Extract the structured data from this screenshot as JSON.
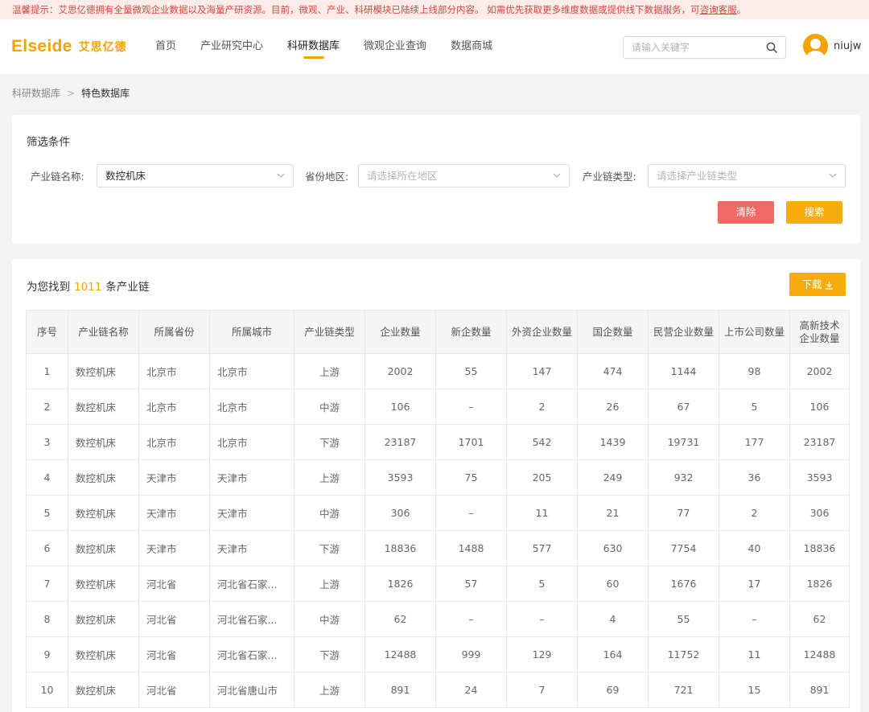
{
  "notice": {
    "text": "温馨提示：艾思亿德拥有全量微观企业数据以及海量产研资源。目前，微观、产业、科研模块已陆续上线部分内容。 如需优先获取更多维度数据或提供线下数据服务，可",
    "link": "咨询客服",
    "end": "。"
  },
  "header": {
    "logo_en": "Elseide",
    "logo_cn": "艾思亿德",
    "nav": [
      {
        "label": "首页",
        "active": false
      },
      {
        "label": "产业研究中心",
        "active": false
      },
      {
        "label": "科研数据库",
        "active": true
      },
      {
        "label": "微观企业查询",
        "active": false
      },
      {
        "label": "数据商城",
        "active": false
      }
    ],
    "search_placeholder": "请输入关键字",
    "username": "niujw"
  },
  "breadcrumb": {
    "parent": "科研数据库",
    "sep": ">",
    "current": "特色数据库"
  },
  "filter": {
    "title": "筛选条件",
    "chain_name_label": "产业链名称:",
    "chain_name_value": "数控机床",
    "province_label": "省份地区:",
    "province_placeholder": "请选择所在地区",
    "chain_type_label": "产业链类型:",
    "chain_type_placeholder": "请选择产业链类型",
    "clear_label": "清除",
    "search_label": "搜索"
  },
  "results": {
    "prefix": "为您找到",
    "count": "1011",
    "suffix": "条产业链",
    "download_label": "下载",
    "columns": [
      "序号",
      "产业链名称",
      "所属省份",
      "所属城市",
      "产业链类型",
      "企业数量",
      "新企数量",
      "外资企业数量",
      "国企数量",
      "民营企业数量",
      "上市公司数量",
      "高新技术企业数量"
    ],
    "rows": [
      [
        "1",
        "数控机床",
        "北京市",
        "北京市",
        "上游",
        "2002",
        "55",
        "147",
        "474",
        "1144",
        "98",
        "2002"
      ],
      [
        "2",
        "数控机床",
        "北京市",
        "北京市",
        "中游",
        "106",
        "–",
        "2",
        "26",
        "67",
        "5",
        "106"
      ],
      [
        "3",
        "数控机床",
        "北京市",
        "北京市",
        "下游",
        "23187",
        "1701",
        "542",
        "1439",
        "19731",
        "177",
        "23187"
      ],
      [
        "4",
        "数控机床",
        "天津市",
        "天津市",
        "上游",
        "3593",
        "75",
        "205",
        "249",
        "932",
        "36",
        "3593"
      ],
      [
        "5",
        "数控机床",
        "天津市",
        "天津市",
        "中游",
        "306",
        "–",
        "11",
        "21",
        "77",
        "2",
        "306"
      ],
      [
        "6",
        "数控机床",
        "天津市",
        "天津市",
        "下游",
        "18836",
        "1488",
        "577",
        "630",
        "7754",
        "40",
        "18836"
      ],
      [
        "7",
        "数控机床",
        "河北省",
        "河北省石家...",
        "上游",
        "1826",
        "57",
        "5",
        "60",
        "1676",
        "17",
        "1826"
      ],
      [
        "8",
        "数控机床",
        "河北省",
        "河北省石家...",
        "中游",
        "62",
        "–",
        "–",
        "4",
        "55",
        "–",
        "62"
      ],
      [
        "9",
        "数控机床",
        "河北省",
        "河北省石家...",
        "下游",
        "12488",
        "999",
        "129",
        "164",
        "11752",
        "11",
        "12488"
      ],
      [
        "10",
        "数控机床",
        "河北省",
        "河北省唐山市",
        "上游",
        "891",
        "24",
        "7",
        "69",
        "721",
        "15",
        "891"
      ]
    ]
  }
}
